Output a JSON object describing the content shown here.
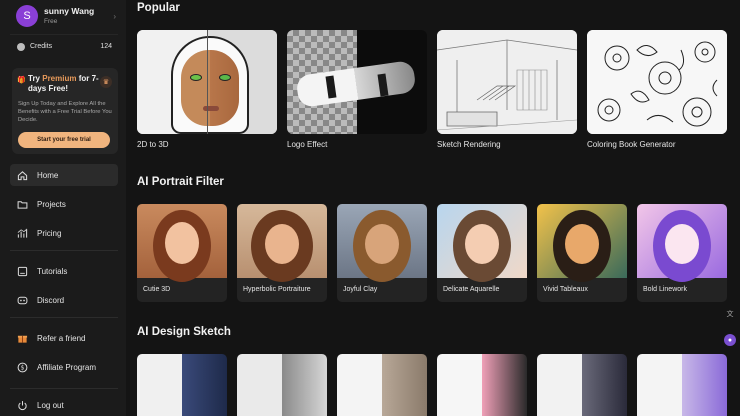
{
  "user": {
    "initial": "S",
    "name": "sunny Wang",
    "plan": "Free"
  },
  "credits": {
    "label": "Credits",
    "value": "124"
  },
  "promo": {
    "title_pre": "Try ",
    "title_highlight": "Premium",
    "title_post": " for 7-days Free!",
    "body": "Sign Up Today and Explore All the Benefits with a Free Trial Before You Decide.",
    "button": "Start your free trial"
  },
  "nav": {
    "home": "Home",
    "projects": "Projects",
    "pricing": "Pricing",
    "tutorials": "Tutorials",
    "discord": "Discord",
    "refer": "Refer a friend",
    "affiliate": "Affiliate Program",
    "logout": "Log out"
  },
  "popular": {
    "title": "Popular",
    "items": [
      {
        "label": "2D to 3D"
      },
      {
        "label": "Logo Effect"
      },
      {
        "label": "Sketch Rendering"
      },
      {
        "label": "Coloring Book Generator"
      }
    ]
  },
  "portrait": {
    "title": "AI Portrait Filter",
    "items": [
      {
        "label": "Cutie 3D"
      },
      {
        "label": "Hyperbolic Portraiture"
      },
      {
        "label": "Joyful Clay"
      },
      {
        "label": "Delicate Aquarelle"
      },
      {
        "label": "Vivid Tableaux"
      },
      {
        "label": "Bold Linework"
      }
    ]
  },
  "design": {
    "title": "AI Design Sketch"
  },
  "colors": {
    "accent": "#f0b47e",
    "premium": "#e89a5a",
    "avatar": "#8a3fd6"
  }
}
